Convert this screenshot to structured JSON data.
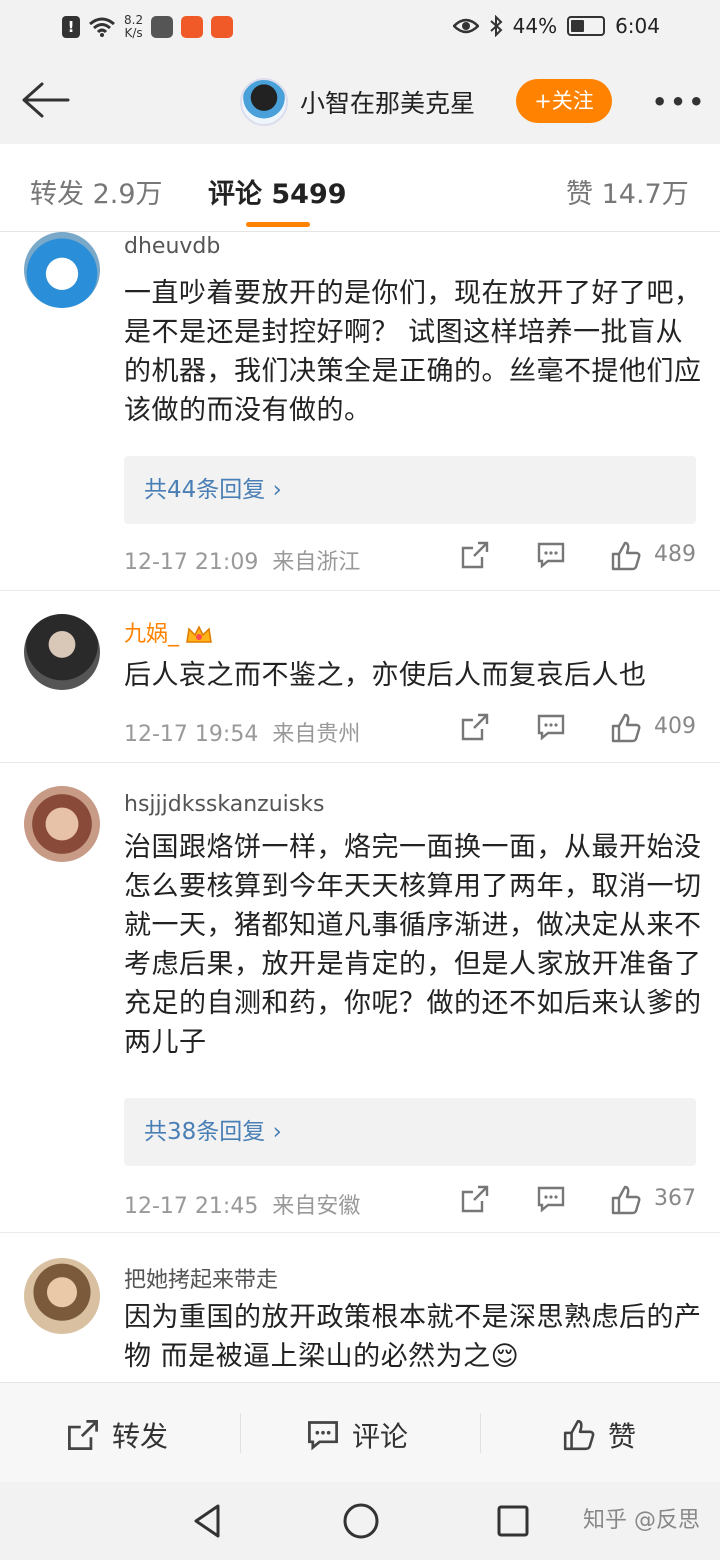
{
  "status_bar": {
    "net_speed_value": "8.2",
    "net_speed_unit": "K/s",
    "battery": "44%",
    "battery_level": 0.44,
    "time": "6:04"
  },
  "header": {
    "user_name": "小智在那美克星",
    "follow_label": "+关注"
  },
  "tabs": {
    "repost": "转发 2.9万",
    "comments": "评论 5499",
    "likes": "赞 14.7万"
  },
  "comments": [
    {
      "name": "dheuvdb",
      "text": "一直吵着要放开的是你们，现在放开了好了吧，是不是还是封控好啊？ 试图这样培养一批盲从的机器，我们决策全是正确的。丝毫不提他们应该做的而没有做的。",
      "replies": "共44条回复",
      "time": "12-17 21:09",
      "location": "来自浙江",
      "likes": "489"
    },
    {
      "name": "九娲_",
      "text": "后人哀之而不鉴之，亦使后人而复哀后人也",
      "time": "12-17 19:54",
      "location": "来自贵州",
      "likes": "409"
    },
    {
      "name": "hsjjjdksskanzuisks",
      "text": "治国跟烙饼一样，烙完一面换一面，从最开始没怎么要核算到今年天天核算用了两年，取消一切就一天，猪都知道凡事循序渐进，做决定从来不考虑后果，放开是肯定的，但是人家放开准备了充足的自测和药，你呢？做的还不如后来认爹的两儿子",
      "replies": "共38条回复",
      "time": "12-17 21:45",
      "location": "来自安徽",
      "likes": "367"
    },
    {
      "name": "把她拷起来带走",
      "text": "因为重国的放开政策根本就不是深思熟虑后的产物 而是被逼上梁山的必然为之😌"
    }
  ],
  "bottom_bar": {
    "repost": "转发",
    "comment": "评论",
    "like": "赞"
  },
  "watermark": "知乎 @反思",
  "colors": {
    "accent": "#ff8200",
    "link": "#4a7fb5"
  }
}
